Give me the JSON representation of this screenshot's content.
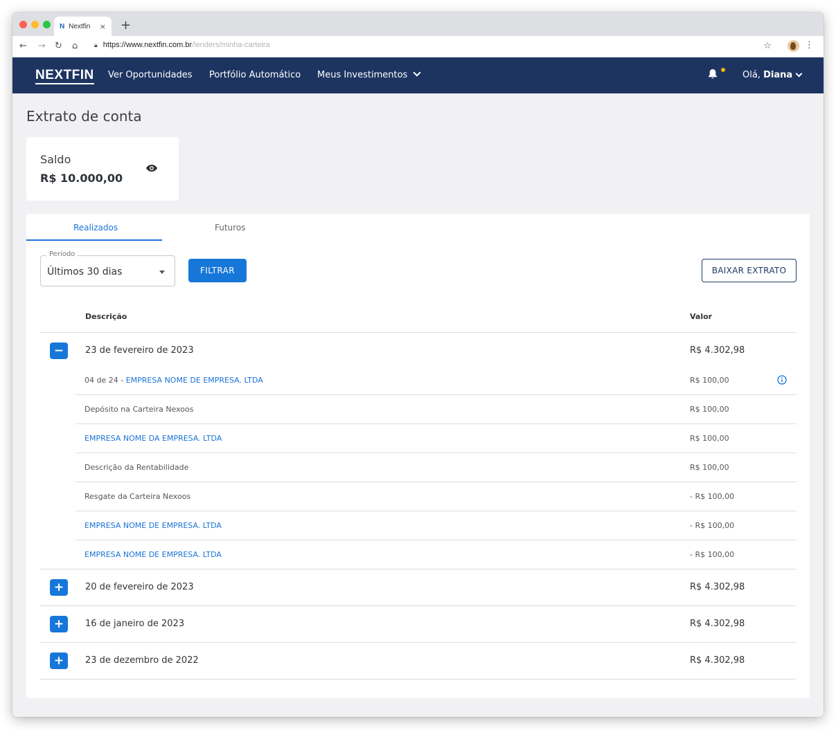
{
  "browser": {
    "tab_favicon": "N",
    "tab_title": "Nextfin",
    "tab_close": "×",
    "new_tab": "+",
    "url_host": "https://www.nextfin.com.br",
    "url_path": "/lenders/minha-carteira",
    "icons": [
      "back-arrow-icon",
      "forward-arrow-icon",
      "reload-icon",
      "home-icon",
      "lock-icon",
      "star-icon",
      "profile-avatar-icon",
      "kebab-menu-icon"
    ]
  },
  "nav": {
    "logo": "NEXTFIN",
    "links": [
      "Ver Oportunidades",
      "Portfólio Automático",
      "Meus Investimentos"
    ],
    "greeting_prefix": "Olá, ",
    "user_name": "Diana",
    "notification_dot_color": "#f4b400",
    "bg_color": "#1d3461"
  },
  "page": {
    "title": "Extrato de conta",
    "saldo_label": "Saldo",
    "saldo_value": "R$ 10.000,00"
  },
  "tabs": [
    "Realizados",
    "Futuros"
  ],
  "filters": {
    "period_label": "Período",
    "period_value": "Últimos 30 dias",
    "filter_button": "FILTRAR",
    "download_button": "BAIXAR EXTRATO"
  },
  "table": {
    "col_description": "Descrição",
    "col_value": "Valor",
    "expanded_group": {
      "toggle": "−",
      "date": "23 de fevereiro de 2023",
      "amount": "R$ 4.302,98",
      "entries": [
        {
          "prefix": "04 de 24 - ",
          "text": "EMPRESA NOME DE EMPRESA. LTDA",
          "value": "R$ 100,00"
        },
        {
          "prefix": "",
          "text": "Depósito na Carteira Nexoos",
          "value": "R$ 100,00"
        },
        {
          "prefix": "",
          "text": "EMPRESA NOME DA EMPRESA. LTDA",
          "value": "R$ 100,00"
        },
        {
          "prefix": "",
          "text": "Descrição da Rentabilidade",
          "value": "R$ 100,00"
        },
        {
          "prefix": "",
          "text": "Resgate da Carteira Nexoos",
          "value": "- R$ 100,00"
        },
        {
          "prefix": "",
          "text": "EMPRESA NOME DE EMPRESA. LTDA",
          "value": "- R$ 100,00"
        },
        {
          "prefix": "",
          "text": "EMPRESA NOME DE EMPRESA. LTDA",
          "value": "- R$ 100,00"
        }
      ]
    },
    "collapsed_groups": [
      {
        "toggle": "+",
        "date": "20 de fevereiro de 2023",
        "amount": "R$ 4.302,98"
      },
      {
        "toggle": "+",
        "date": "16 de janeiro de 2023",
        "amount": "R$ 4.302,98"
      },
      {
        "toggle": "+",
        "date": "23 de dezembro de 2022",
        "amount": "R$ 4.302,98"
      }
    ]
  },
  "colors": {
    "primary": "#1677d9",
    "link": "#1a73d8",
    "navy": "#1e3a66",
    "background": "#f1f1f3"
  }
}
